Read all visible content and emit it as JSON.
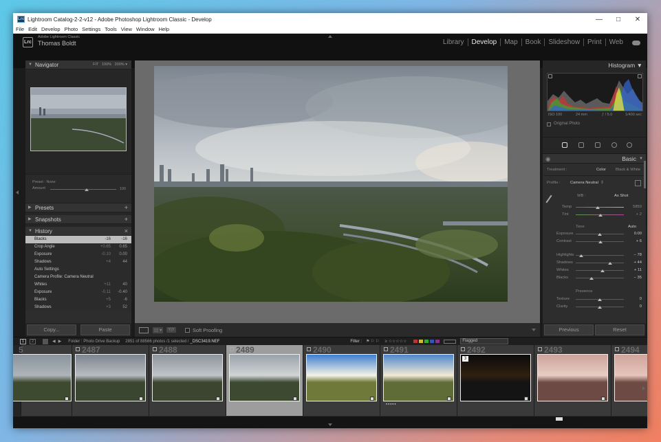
{
  "window": {
    "title": "Lightroom Catalog-2-2-v12 - Adobe Photoshop Lightroom Classic - Develop",
    "app_icon": "Lrc",
    "controls": {
      "minimize": "—",
      "maximize": "□",
      "close": "✕"
    }
  },
  "menu": [
    "File",
    "Edit",
    "Develop",
    "Photo",
    "Settings",
    "Tools",
    "View",
    "Window",
    "Help"
  ],
  "identity": {
    "logo": "Lrc",
    "product": "Adobe Lightroom Classic",
    "user": "Thomas Boldt"
  },
  "modules": [
    {
      "label": "Library",
      "active": false
    },
    {
      "label": "Develop",
      "active": true
    },
    {
      "label": "Map",
      "active": false
    },
    {
      "label": "Book",
      "active": false
    },
    {
      "label": "Slideshow",
      "active": false
    },
    {
      "label": "Print",
      "active": false
    },
    {
      "label": "Web",
      "active": false
    }
  ],
  "left_panel": {
    "navigator": {
      "title": "Navigator",
      "options": [
        "FIT",
        "100%",
        "200%"
      ]
    },
    "preset": {
      "label": "Preset : None",
      "amount_label": "Amount",
      "amount_value": "100",
      "amount_fraction": 0.55
    },
    "presets_title": "Presets",
    "snapshots_title": "Snapshots",
    "history_title": "History",
    "history": [
      {
        "label": "Blacks",
        "v1": "-16",
        "v2": "-16",
        "selected": true
      },
      {
        "label": "Crop Angle",
        "v1": "+0.65",
        "v2": "0.65",
        "selected": false
      },
      {
        "label": "Exposure",
        "v1": "-0.10",
        "v2": "0.00",
        "selected": false
      },
      {
        "label": "Shadows",
        "v1": "+4",
        "v2": "44",
        "selected": false
      },
      {
        "label": "Auto Settings",
        "v1": "",
        "v2": "",
        "selected": false
      },
      {
        "label": "Camera Profile: Camera Neutral",
        "v1": "",
        "v2": "",
        "selected": false
      },
      {
        "label": "Whites",
        "v1": "+11",
        "v2": "40",
        "selected": false
      },
      {
        "label": "Exposure",
        "v1": "-0.11",
        "v2": "-0.40",
        "selected": false
      },
      {
        "label": "Blacks",
        "v1": "+5",
        "v2": "-6",
        "selected": false
      },
      {
        "label": "Shadows",
        "v1": "+3",
        "v2": "52",
        "selected": false
      }
    ],
    "copy_label": "Copy...",
    "paste_label": "Paste"
  },
  "toolbar": {
    "view_icons": "▭",
    "ratio_label": "Y|Y",
    "soft_proofing": "Soft Proofing"
  },
  "right_panel": {
    "histogram_title": "Histogram",
    "exif": {
      "iso": "ISO 100",
      "focal": "24 mm",
      "aperture": "ƒ / 5.0",
      "shutter": "1/400 sec"
    },
    "original_photo": "Original Photo",
    "basic_title": "Basic",
    "treatment": {
      "label": "Treatment :",
      "color": "Color",
      "bw": "Black & White"
    },
    "profile": {
      "label": "Profile :",
      "value": "Camera Neutral"
    },
    "wb": {
      "label": "WB :",
      "value": "As Shot"
    },
    "temp": {
      "label": "Temp",
      "value": "5850",
      "fraction": 0.45
    },
    "tint": {
      "label": "Tint",
      "value": "+ 2",
      "fraction": 0.52
    },
    "tone_title": "Tone",
    "auto_label": "Auto",
    "sliders": [
      {
        "label": "Exposure",
        "value": "0.00",
        "fraction": 0.5
      },
      {
        "label": "Contrast",
        "value": "+ 6",
        "fraction": 0.52
      },
      {
        "label": "Highlights",
        "value": "− 78",
        "fraction": 0.12
      },
      {
        "label": "Shadows",
        "value": "+ 44",
        "fraction": 0.72
      },
      {
        "label": "Whites",
        "value": "+ 11",
        "fraction": 0.56
      },
      {
        "label": "Blacks",
        "value": "− 35",
        "fraction": 0.33
      }
    ],
    "presence_title": "Presence",
    "presence": [
      {
        "label": "Texture",
        "value": "0",
        "fraction": 0.5
      },
      {
        "label": "Clarity",
        "value": "0",
        "fraction": 0.5
      }
    ],
    "previous_label": "Previous",
    "reset_label": "Reset"
  },
  "filmstrip_bar": {
    "page1": "1",
    "page2": "2",
    "folder": "Folder : Photo Drive Backup",
    "count": "2851 of 88566 photos /1 selected /",
    "filename": "_DSC3419.NEF",
    "filter_label": "Filter :",
    "rating_filter": "≥ ☆☆☆☆☆",
    "flag_select": "Flagged"
  },
  "filmstrip": [
    {
      "num": "5"
    },
    {
      "num": "2487"
    },
    {
      "num": "2488"
    },
    {
      "num": "2489",
      "selected": true
    },
    {
      "num": "2490"
    },
    {
      "num": "2491",
      "stars": "•••••"
    },
    {
      "num": "2492",
      "badge": "3"
    },
    {
      "num": "2493"
    },
    {
      "num": "2494"
    }
  ],
  "colors": {
    "accent": "#e8e8e8",
    "panel": "#2d2d2d",
    "selected_row": "#bdbdbd"
  }
}
